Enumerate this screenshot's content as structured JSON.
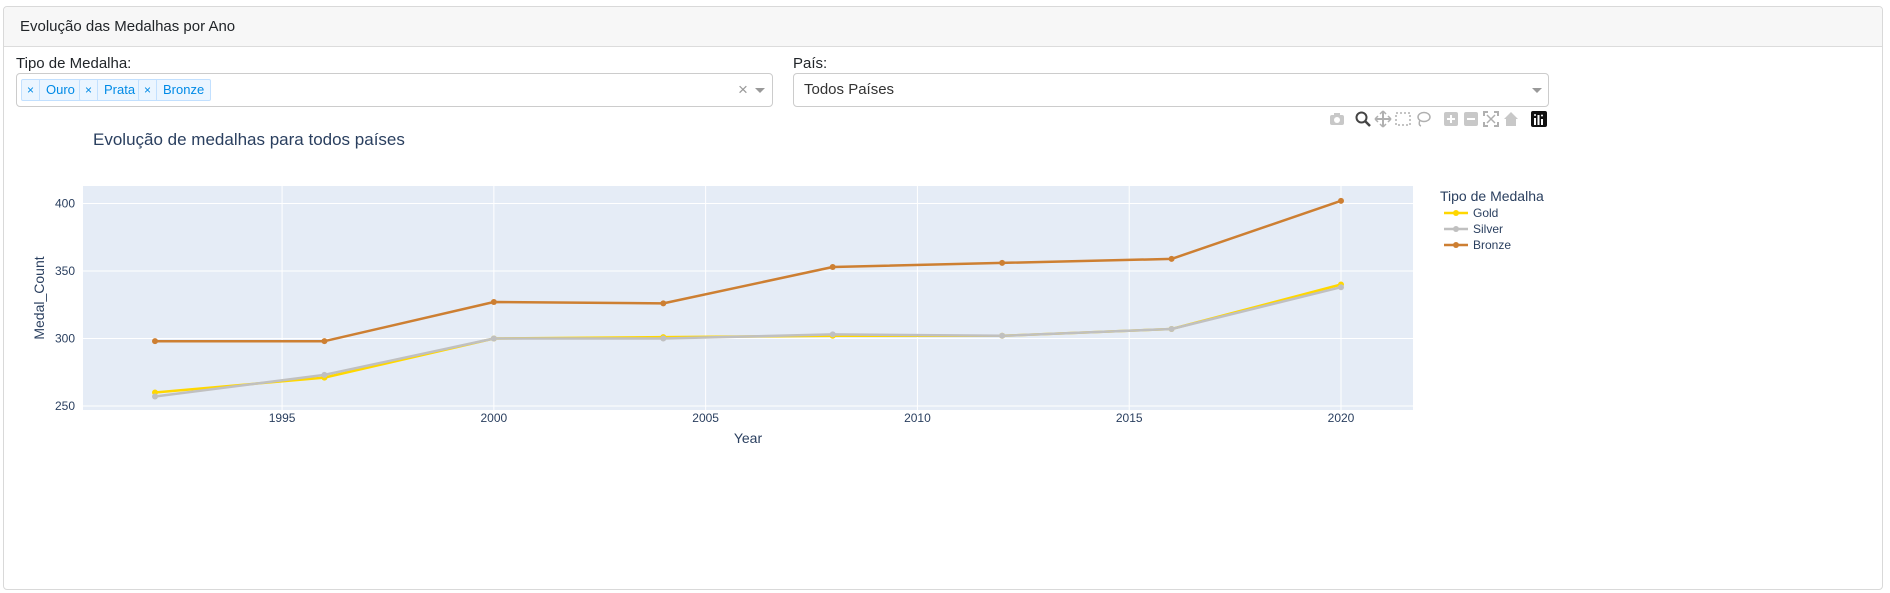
{
  "card": {
    "title": "Evolução das Medalhas por Ano"
  },
  "filters": {
    "medal_type": {
      "label": "Tipo de Medalha:",
      "selected": [
        "Ouro",
        "Prata",
        "Bronze"
      ],
      "remove_symbol": "×",
      "clear_symbol": "×"
    },
    "country": {
      "label": "País:",
      "value": "Todos Países"
    }
  },
  "modebar": {
    "icons": [
      "camera-icon",
      "zoom-icon",
      "pan-icon",
      "box-select-icon",
      "lasso-icon",
      "zoom-in-icon",
      "zoom-out-icon",
      "autoscale-icon",
      "reset-axes-icon",
      "plotly-logo-icon"
    ]
  },
  "chart_data": {
    "type": "line",
    "title": "Evolução de medalhas para todos países",
    "xlabel": "Year",
    "ylabel": "Medal_Count",
    "x": [
      1992,
      1996,
      2000,
      2004,
      2008,
      2012,
      2016,
      2020
    ],
    "xlim": [
      1990.3,
      2021.7
    ],
    "ylim": [
      247,
      413
    ],
    "xticks": [
      1995,
      2000,
      2005,
      2010,
      2015,
      2020
    ],
    "yticks": [
      250,
      300,
      350,
      400
    ],
    "grid": true,
    "legend_title": "Tipo de Medalha",
    "legend_position": "top-right",
    "series": [
      {
        "name": "Gold",
        "color": "#FFD700",
        "values": [
          260,
          271,
          300,
          301,
          302,
          302,
          307,
          340
        ]
      },
      {
        "name": "Silver",
        "color": "#C0C0C0",
        "values": [
          257,
          273,
          300,
          300,
          303,
          302,
          307,
          338
        ]
      },
      {
        "name": "Bronze",
        "color": "#CD7F32",
        "values": [
          298,
          298,
          327,
          326,
          353,
          356,
          359,
          402
        ]
      }
    ]
  }
}
